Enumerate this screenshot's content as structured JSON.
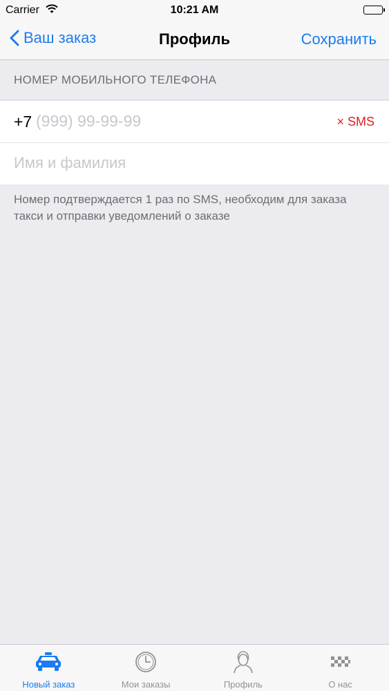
{
  "status_bar": {
    "carrier": "Carrier",
    "time": "10:21 AM",
    "wifi_icon": "wifi-icon",
    "battery_icon": "battery-icon",
    "battery_level": 1.0
  },
  "nav": {
    "back_label": "Ваш заказ",
    "title": "Профиль",
    "save_label": "Сохранить"
  },
  "phone_section": {
    "header": "НОМЕР МОБИЛЬНОГО ТЕЛЕФОНА",
    "prefix": "+7",
    "phone_value": "",
    "phone_placeholder": "(999) 99-99-99",
    "sms_label": "× SMS"
  },
  "name_field": {
    "value": "",
    "placeholder": "Имя и фамилия"
  },
  "footnote": "Номер подтверждается 1 раз по SMS, необходим для заказа такси и отправки уведомлений о заказе",
  "tabs": [
    {
      "label": "Новый заказ",
      "icon": "taxi-car-icon",
      "active": true
    },
    {
      "label": "Мои заказы",
      "icon": "clock-icon",
      "active": false
    },
    {
      "label": "Профиль",
      "icon": "person-icon",
      "active": false
    },
    {
      "label": "О нас",
      "icon": "taxi-checker-icon",
      "active": false
    }
  ],
  "colors": {
    "accent": "#1a7cf0",
    "sms_red": "#e21d24",
    "background": "#ebebf0",
    "inactive_tab": "#929292"
  }
}
